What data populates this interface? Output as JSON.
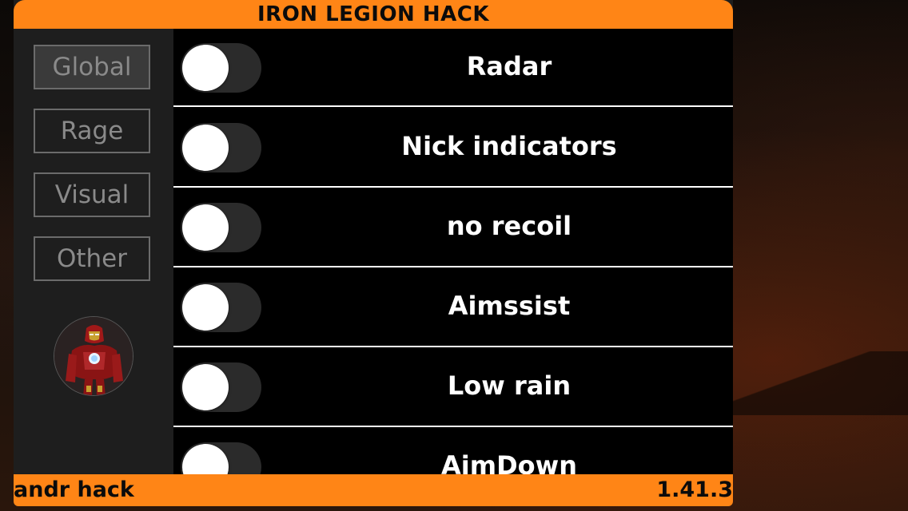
{
  "header": {
    "title": "IRON LEGION HACK"
  },
  "sidebar": {
    "tabs": [
      {
        "label": "Global",
        "active": true
      },
      {
        "label": "Rage",
        "active": false
      },
      {
        "label": "Visual",
        "active": false
      },
      {
        "label": "Other",
        "active": false
      }
    ],
    "avatar_icon": "iron-man-avatar-icon"
  },
  "features": [
    {
      "label": "Radar",
      "enabled": false
    },
    {
      "label": "Nick indicators",
      "enabled": false
    },
    {
      "label": "no recoil",
      "enabled": false
    },
    {
      "label": "Aimssist",
      "enabled": false
    },
    {
      "label": "Low rain",
      "enabled": false
    },
    {
      "label": "AimDown",
      "enabled": false
    }
  ],
  "footer": {
    "left_text": "andr hack",
    "version": "1.41.3"
  },
  "colors": {
    "accent": "#ff8516",
    "panel": "#1e1e1e",
    "list_bg": "#000000",
    "toggle_off": "#2b2b2b",
    "text": "#ffffff"
  }
}
